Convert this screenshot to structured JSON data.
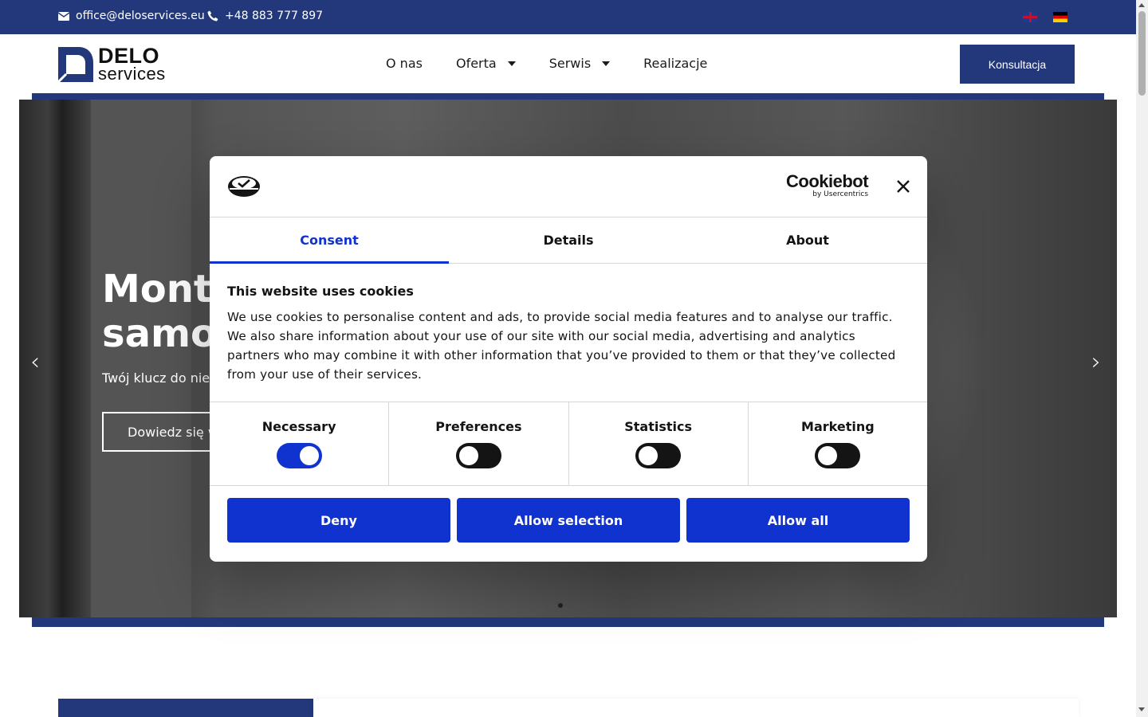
{
  "topbar": {
    "email": "office@deloservices.eu",
    "phone": "+48 883 777 897",
    "languages": [
      "English",
      "Deutsch"
    ]
  },
  "header": {
    "logo_line1": "DELO",
    "logo_line2": "services",
    "nav": [
      {
        "label": "O nas",
        "dropdown": false
      },
      {
        "label": "Oferta",
        "dropdown": true
      },
      {
        "label": "Serwis",
        "dropdown": true
      },
      {
        "label": "Realizacje",
        "dropdown": false
      }
    ],
    "cta_label": "Konsultacja"
  },
  "hero": {
    "title_line1": "Monta",
    "title_line2": "samoc",
    "subtitle": "Twój klucz do niez",
    "button_label": "Dowiedz się w",
    "prev_arrow": "‹",
    "next_arrow": "›"
  },
  "cookie_dialog": {
    "brand": "Cookiebot",
    "brand_sub": "by Usercentrics",
    "tabs": [
      "Consent",
      "Details",
      "About"
    ],
    "active_tab": "Consent",
    "title": "This website uses cookies",
    "text": "We use cookies to personalise content and ads, to provide social media features and to analyse our traffic. We also share information about your use of our site with our social media, advertising and analytics partners who may combine it with other information that you’ve provided to them or that they’ve collected from your use of their services.",
    "categories": [
      {
        "label": "Necessary",
        "enabled": true
      },
      {
        "label": "Preferences",
        "enabled": false
      },
      {
        "label": "Statistics",
        "enabled": false
      },
      {
        "label": "Marketing",
        "enabled": false
      }
    ],
    "buttons": {
      "deny": "Deny",
      "allow_selection": "Allow selection",
      "allow_all": "Allow all"
    }
  },
  "colors": {
    "brand_navy": "#22387a",
    "cookie_accent": "#1032cf"
  }
}
